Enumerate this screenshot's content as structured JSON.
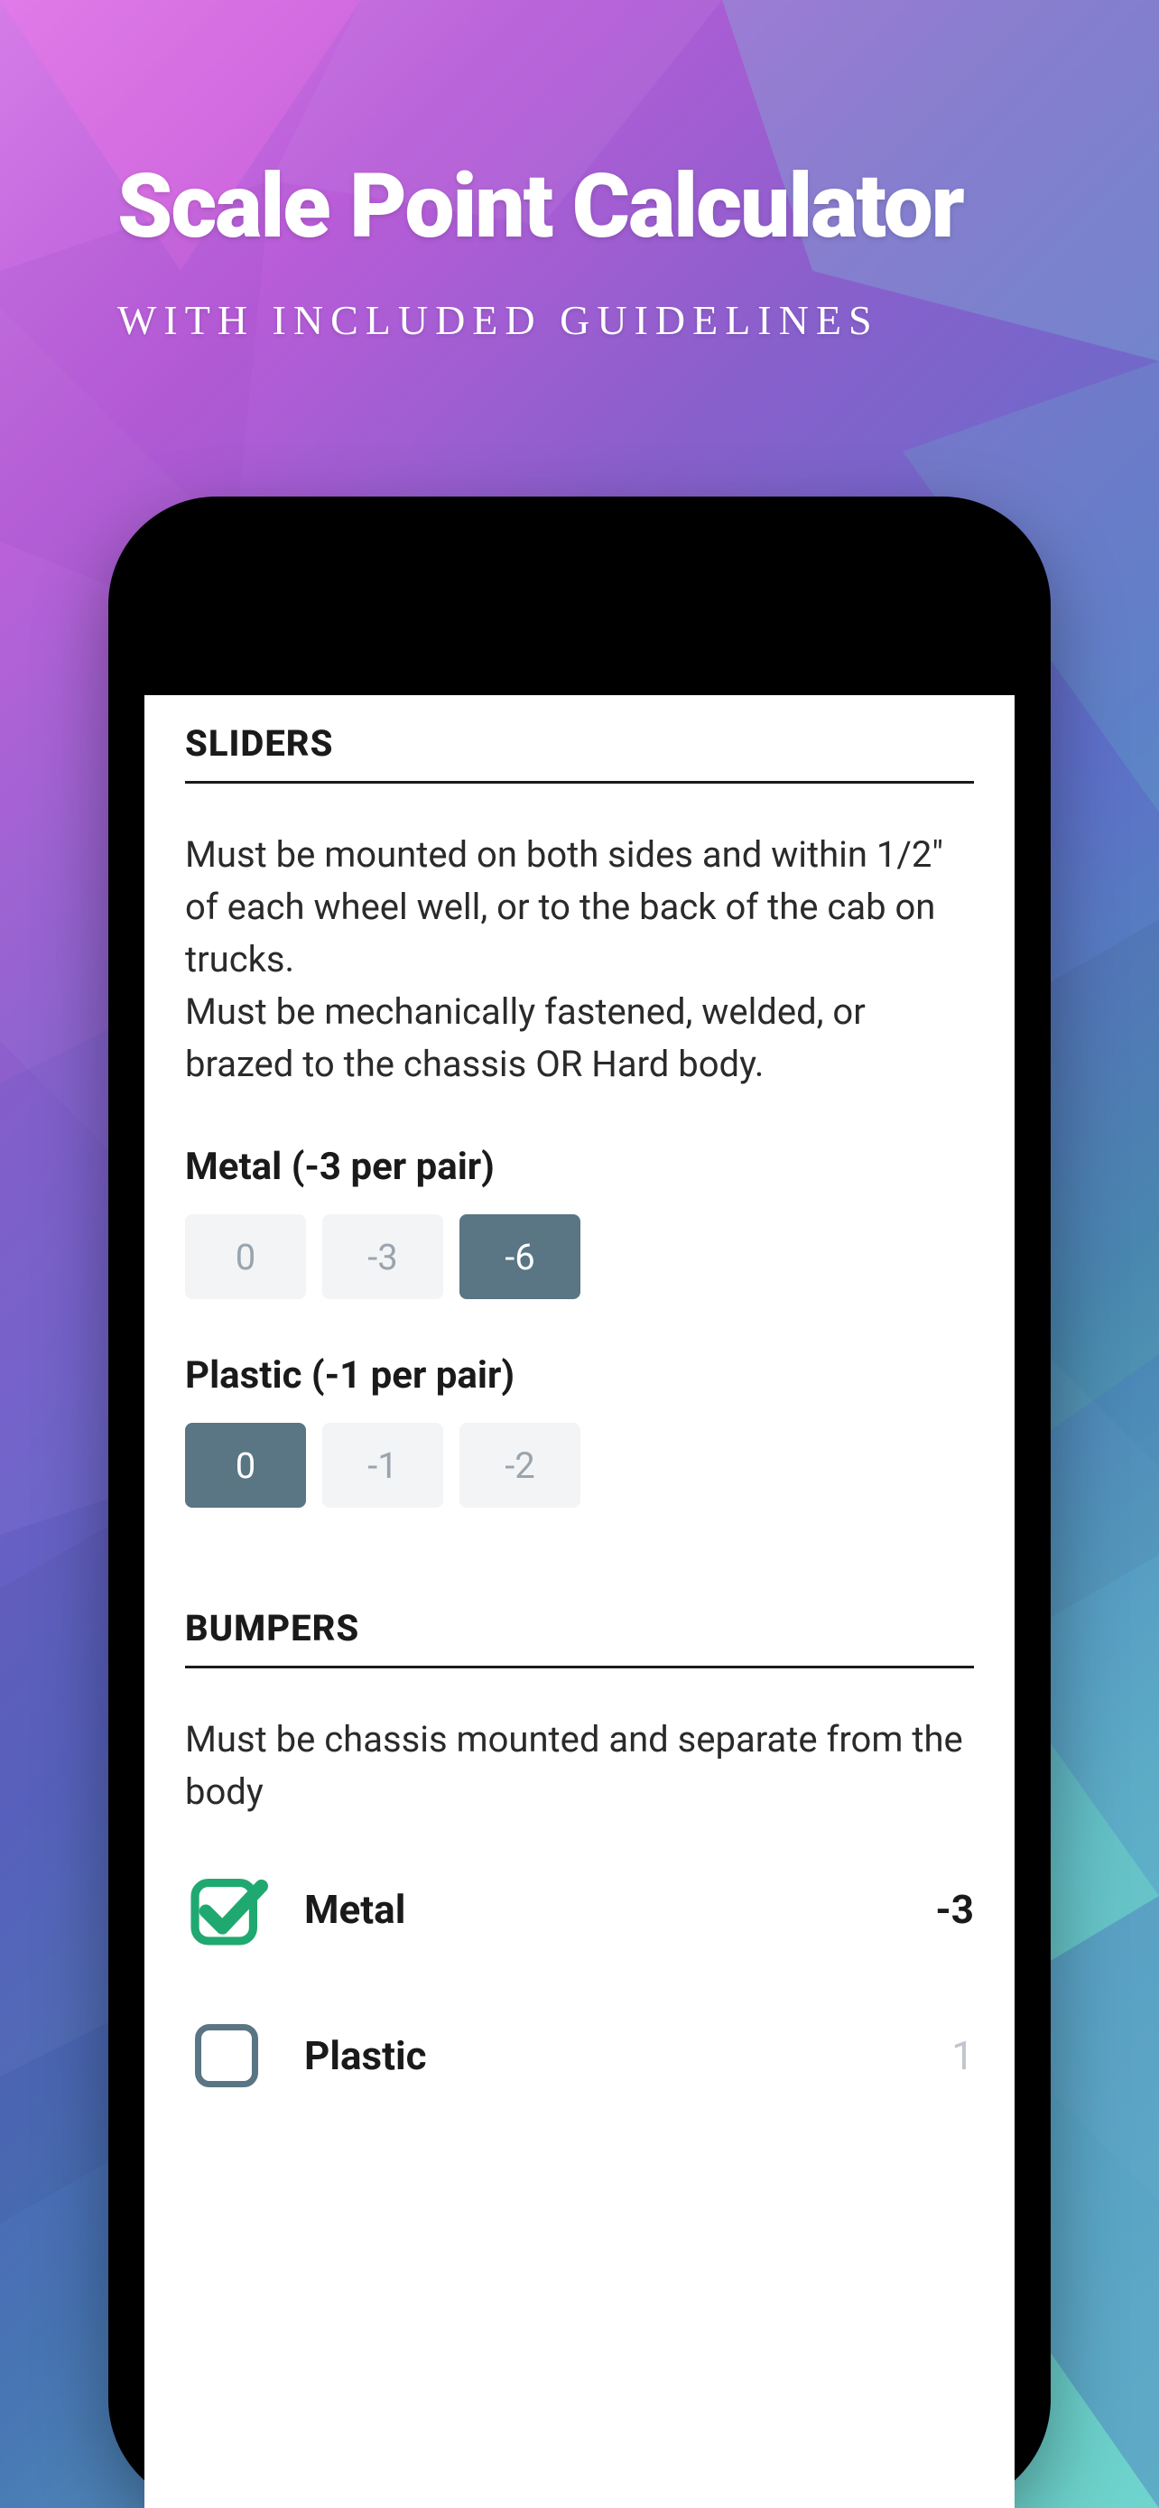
{
  "header": {
    "title": "Scale Point Calculator",
    "subtitle": "WITH INCLUDED GUIDELINES"
  },
  "sections": {
    "sliders": {
      "title": "SLIDERS",
      "guideline_line1": "Must be mounted on both sides and within 1/2\" of each wheel well, or to the back of the cab on trucks.",
      "guideline_line2": "Must be mechanically fastened, welded, or brazed to the chassis OR Hard body.",
      "metal": {
        "label": "Metal (-3 per pair)",
        "options": [
          "0",
          "-3",
          "-6"
        ],
        "selected_index": 2
      },
      "plastic": {
        "label": "Plastic (-1 per pair)",
        "options": [
          "0",
          "-1",
          "-2"
        ],
        "selected_index": 0
      }
    },
    "bumpers": {
      "title": "BUMPERS",
      "guideline": "Must be chassis mounted and separate from the body",
      "metal": {
        "label": "Metal",
        "value": "-3",
        "checked": true
      },
      "plastic": {
        "label": "Plastic",
        "value": "1",
        "checked": false
      }
    }
  },
  "colors": {
    "segment_selected_bg": "#5a7583",
    "segment_unselected_bg": "#f2f4f6",
    "check_green": "#1fa971"
  }
}
